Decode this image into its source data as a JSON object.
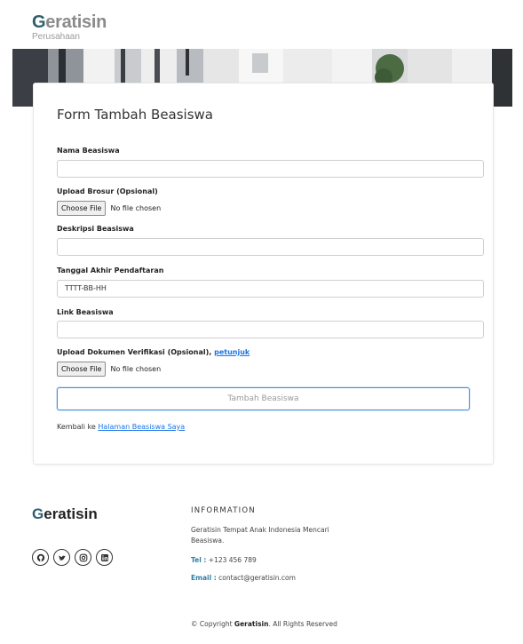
{
  "brand": {
    "g": "G",
    "rest": "eratisin",
    "subtitle": "Perusahaan"
  },
  "form": {
    "title": "Form Tambah Beasiswa",
    "nama_label": "Nama Beasiswa",
    "nama_value": "",
    "brosur_label": "Upload Brosur (Opsional)",
    "brosur_button": "Choose File",
    "brosur_status": "No file chosen",
    "deskripsi_label": "Deskripsi Beasiswa",
    "deskripsi_value": "",
    "tanggal_label": "Tanggal Akhir Pendaftaran",
    "tanggal_placeholder": "TTTT-BB-HH",
    "link_label": "Link Beasiswa",
    "link_value": "",
    "dokumen_label": "Upload Dokumen Verifikasi (Opsional),",
    "dokumen_link": "petunjuk",
    "dokumen_button": "Choose File",
    "dokumen_status": "No file chosen",
    "submit_label": "Tambah Beasiswa",
    "back_text": "Kembali ke",
    "back_link": "Halaman Beasiswa Saya"
  },
  "footer": {
    "logo_g": "G",
    "logo_rest": "eratisin",
    "socials": [
      "github-icon",
      "twitter-icon",
      "instagram-icon",
      "linkedin-icon"
    ],
    "info_heading": "INFORMATION",
    "info_text": "Geratisin Tempat Anak Indonesia Mencari Beasiswa.",
    "tel_label": "Tel :",
    "tel_value": "+123 456 789",
    "email_label": "Email :",
    "email_value": "contact@geratisin.com",
    "copy_prefix": "© Copyright",
    "copy_brand": "Geratisin",
    "copy_suffix": ". All Rights Reserved"
  },
  "colors": {
    "accent": "#2f5f6e",
    "link": "#1a73e8",
    "footer_key": "#2f7fa8"
  }
}
